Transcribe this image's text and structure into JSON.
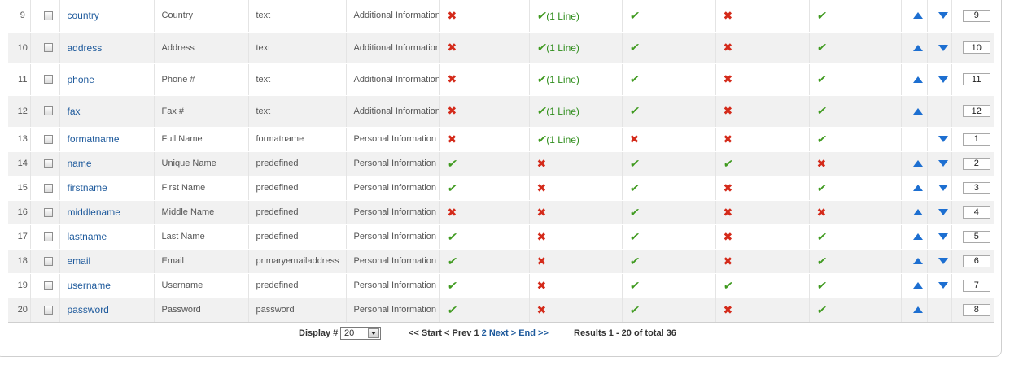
{
  "rows": [
    {
      "num": "9",
      "name": "country",
      "label": "Country",
      "type": "text",
      "group": "Additional Information",
      "c1": "no",
      "c2": "yes-line",
      "c2text": "(1 Line)",
      "c3": "yes",
      "c4": "no",
      "c5": "yes",
      "up": true,
      "down": true,
      "order": "9"
    },
    {
      "num": "10",
      "name": "address",
      "label": "Address",
      "type": "text",
      "group": "Additional Information",
      "c1": "no",
      "c2": "yes-line",
      "c2text": "(1 Line)",
      "c3": "yes",
      "c4": "no",
      "c5": "yes",
      "up": true,
      "down": true,
      "order": "10"
    },
    {
      "num": "11",
      "name": "phone",
      "label": "Phone #",
      "type": "text",
      "group": "Additional Information",
      "c1": "no",
      "c2": "yes-line",
      "c2text": "(1 Line)",
      "c3": "yes",
      "c4": "no",
      "c5": "yes",
      "up": true,
      "down": true,
      "order": "11"
    },
    {
      "num": "12",
      "name": "fax",
      "label": "Fax #",
      "type": "text",
      "group": "Additional Information",
      "c1": "no",
      "c2": "yes-line",
      "c2text": "(1 Line)",
      "c3": "yes",
      "c4": "no",
      "c5": "yes",
      "up": true,
      "down": false,
      "order": "12"
    },
    {
      "num": "13",
      "name": "formatname",
      "label": "Full Name",
      "type": "formatname",
      "group": "Personal Information",
      "c1": "no",
      "c2": "yes-line",
      "c2text": "(1 Line)",
      "c3": "no",
      "c4": "no",
      "c5": "yes",
      "up": false,
      "down": true,
      "order": "1"
    },
    {
      "num": "14",
      "name": "name",
      "label": "Unique Name",
      "type": "predefined",
      "group": "Personal Information",
      "c1": "yes",
      "c2": "no",
      "c2text": "",
      "c3": "yes",
      "c4": "yes",
      "c5": "no",
      "up": true,
      "down": true,
      "order": "2"
    },
    {
      "num": "15",
      "name": "firstname",
      "label": "First Name",
      "type": "predefined",
      "group": "Personal Information",
      "c1": "yes",
      "c2": "no",
      "c2text": "",
      "c3": "yes",
      "c4": "no",
      "c5": "yes",
      "up": true,
      "down": true,
      "order": "3"
    },
    {
      "num": "16",
      "name": "middlename",
      "label": "Middle Name",
      "type": "predefined",
      "group": "Personal Information",
      "c1": "no",
      "c2": "no",
      "c2text": "",
      "c3": "yes",
      "c4": "no",
      "c5": "no",
      "up": true,
      "down": true,
      "order": "4"
    },
    {
      "num": "17",
      "name": "lastname",
      "label": "Last Name",
      "type": "predefined",
      "group": "Personal Information",
      "c1": "yes",
      "c2": "no",
      "c2text": "",
      "c3": "yes",
      "c4": "no",
      "c5": "yes",
      "up": true,
      "down": true,
      "order": "5"
    },
    {
      "num": "18",
      "name": "email",
      "label": "Email",
      "type": "primaryemailaddress",
      "group": "Personal Information",
      "c1": "yes",
      "c2": "no",
      "c2text": "",
      "c3": "yes",
      "c4": "no",
      "c5": "yes",
      "up": true,
      "down": true,
      "order": "6"
    },
    {
      "num": "19",
      "name": "username",
      "label": "Username",
      "type": "predefined",
      "group": "Personal Information",
      "c1": "yes",
      "c2": "no",
      "c2text": "",
      "c3": "yes",
      "c4": "yes",
      "c5": "yes",
      "up": true,
      "down": true,
      "order": "7"
    },
    {
      "num": "20",
      "name": "password",
      "label": "Password",
      "type": "password",
      "group": "Personal Information",
      "c1": "yes",
      "c2": "no",
      "c2text": "",
      "c3": "yes",
      "c4": "no",
      "c5": "yes",
      "up": true,
      "down": false,
      "order": "8"
    }
  ],
  "footer": {
    "display_label": "Display #",
    "display_value": "20",
    "pager_start": "<< Start",
    "pager_prev": "< Prev",
    "pager_current": "1",
    "pager_page2": "2",
    "pager_next": "Next >",
    "pager_end": "End >>",
    "results": "Results 1 - 20 of total 36"
  },
  "icons": {
    "yes": "check-icon",
    "no": "cross-icon",
    "up": "move-up-arrow-icon",
    "down": "move-down-arrow-icon"
  },
  "colors": {
    "link": "#1e5a9c",
    "yes": "#3f9a1f",
    "no": "#d42a1a",
    "arrow": "#1d6fd1",
    "row_alt": "#f1f1f1"
  }
}
